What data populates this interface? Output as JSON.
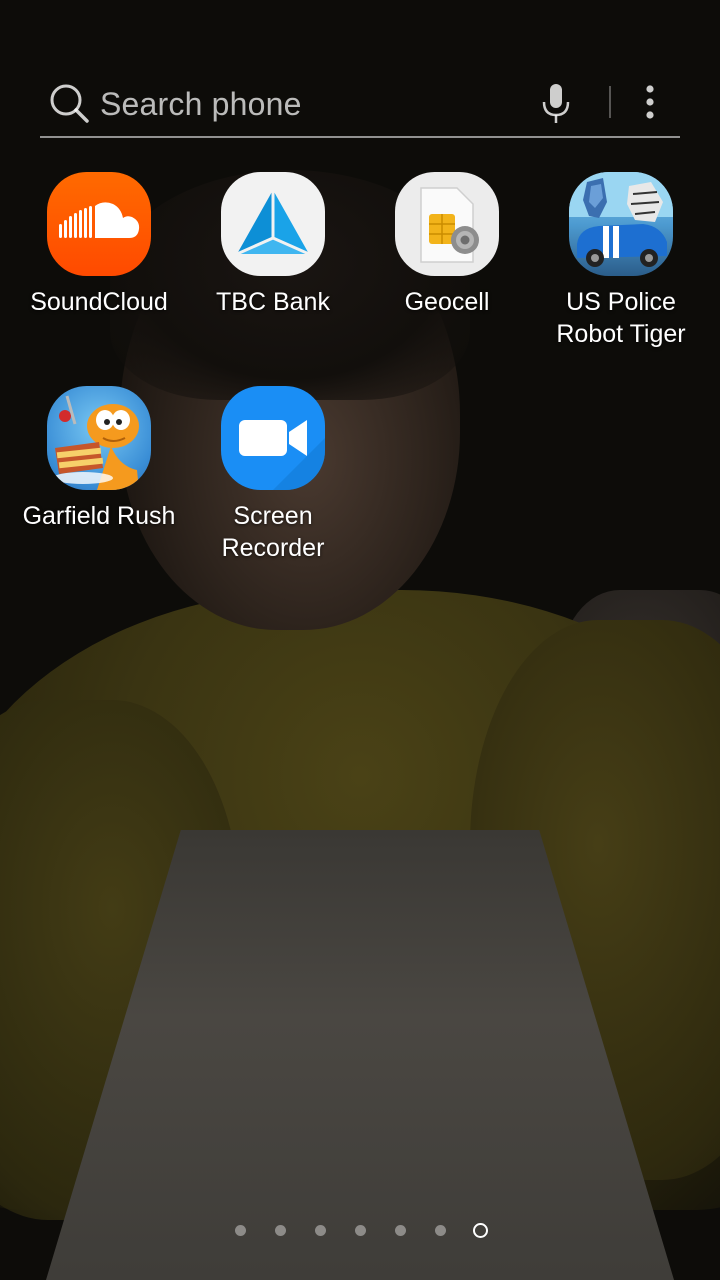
{
  "search": {
    "placeholder": "Search phone",
    "icons": [
      "search-icon",
      "mic-icon",
      "more-vert-icon"
    ]
  },
  "apps": [
    {
      "label_lines": [
        "SoundCloud"
      ],
      "icon": "soundcloud-icon"
    },
    {
      "label_lines": [
        "TBC Bank"
      ],
      "icon": "tbc-bank-icon"
    },
    {
      "label_lines": [
        "Geocell"
      ],
      "icon": "geocell-sim-icon"
    },
    {
      "label_lines": [
        "US Police",
        "Robot Tiger"
      ],
      "icon": "us-police-robot-tiger-icon"
    },
    {
      "label_lines": [
        "Garfield Rush"
      ],
      "icon": "garfield-rush-icon"
    },
    {
      "label_lines": [
        "Screen",
        "Recorder"
      ],
      "icon": "screen-recorder-icon"
    }
  ],
  "page_indicator": {
    "total_pages": 7,
    "current_page": 7
  },
  "colors": {
    "soundcloud": "#ff5500",
    "tbc": "#1aa3e8",
    "screen_recorder": "#1a8ef5"
  }
}
